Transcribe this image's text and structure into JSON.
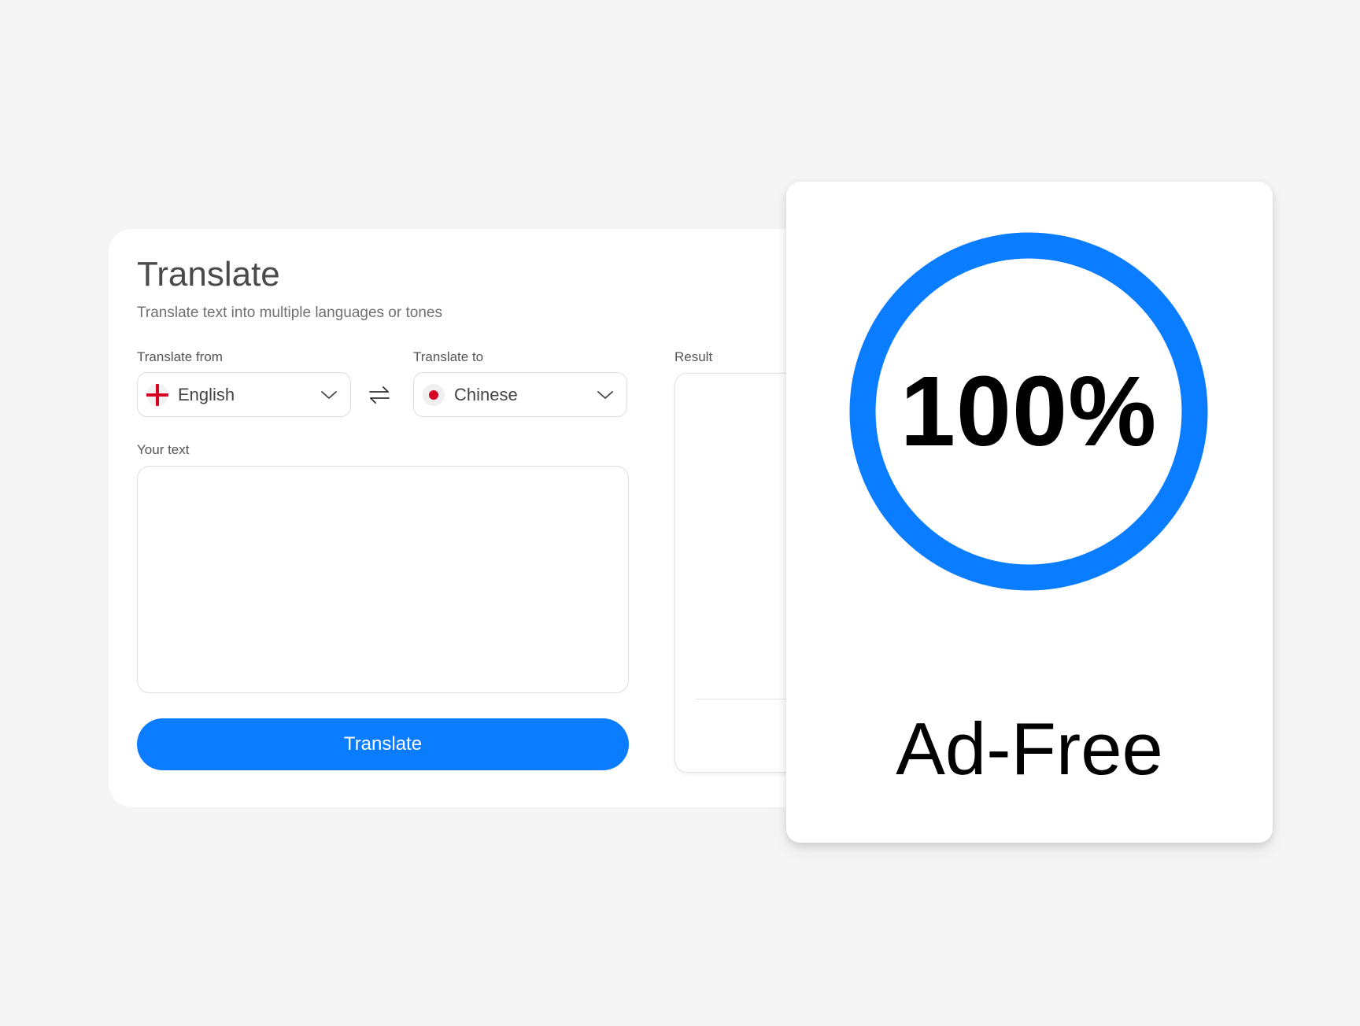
{
  "translator": {
    "title": "Translate",
    "subtitle": "Translate text into multiple languages or tones",
    "from": {
      "label": "Translate from",
      "value": "English",
      "flag_icon": "england-flag-icon"
    },
    "to": {
      "label": "Translate to",
      "value": "Chinese",
      "flag_icon": "red-dot-flag-icon"
    },
    "input": {
      "label": "Your text",
      "value": "",
      "placeholder": ""
    },
    "result": {
      "label": "Result"
    },
    "button_label": "Translate"
  },
  "promo": {
    "percent_text": "100%",
    "progress": 1.0,
    "caption": "Ad-Free"
  },
  "colors": {
    "accent": "#0a7cff",
    "page_background": "#f5f5f5",
    "flag_red": "#d80027"
  }
}
